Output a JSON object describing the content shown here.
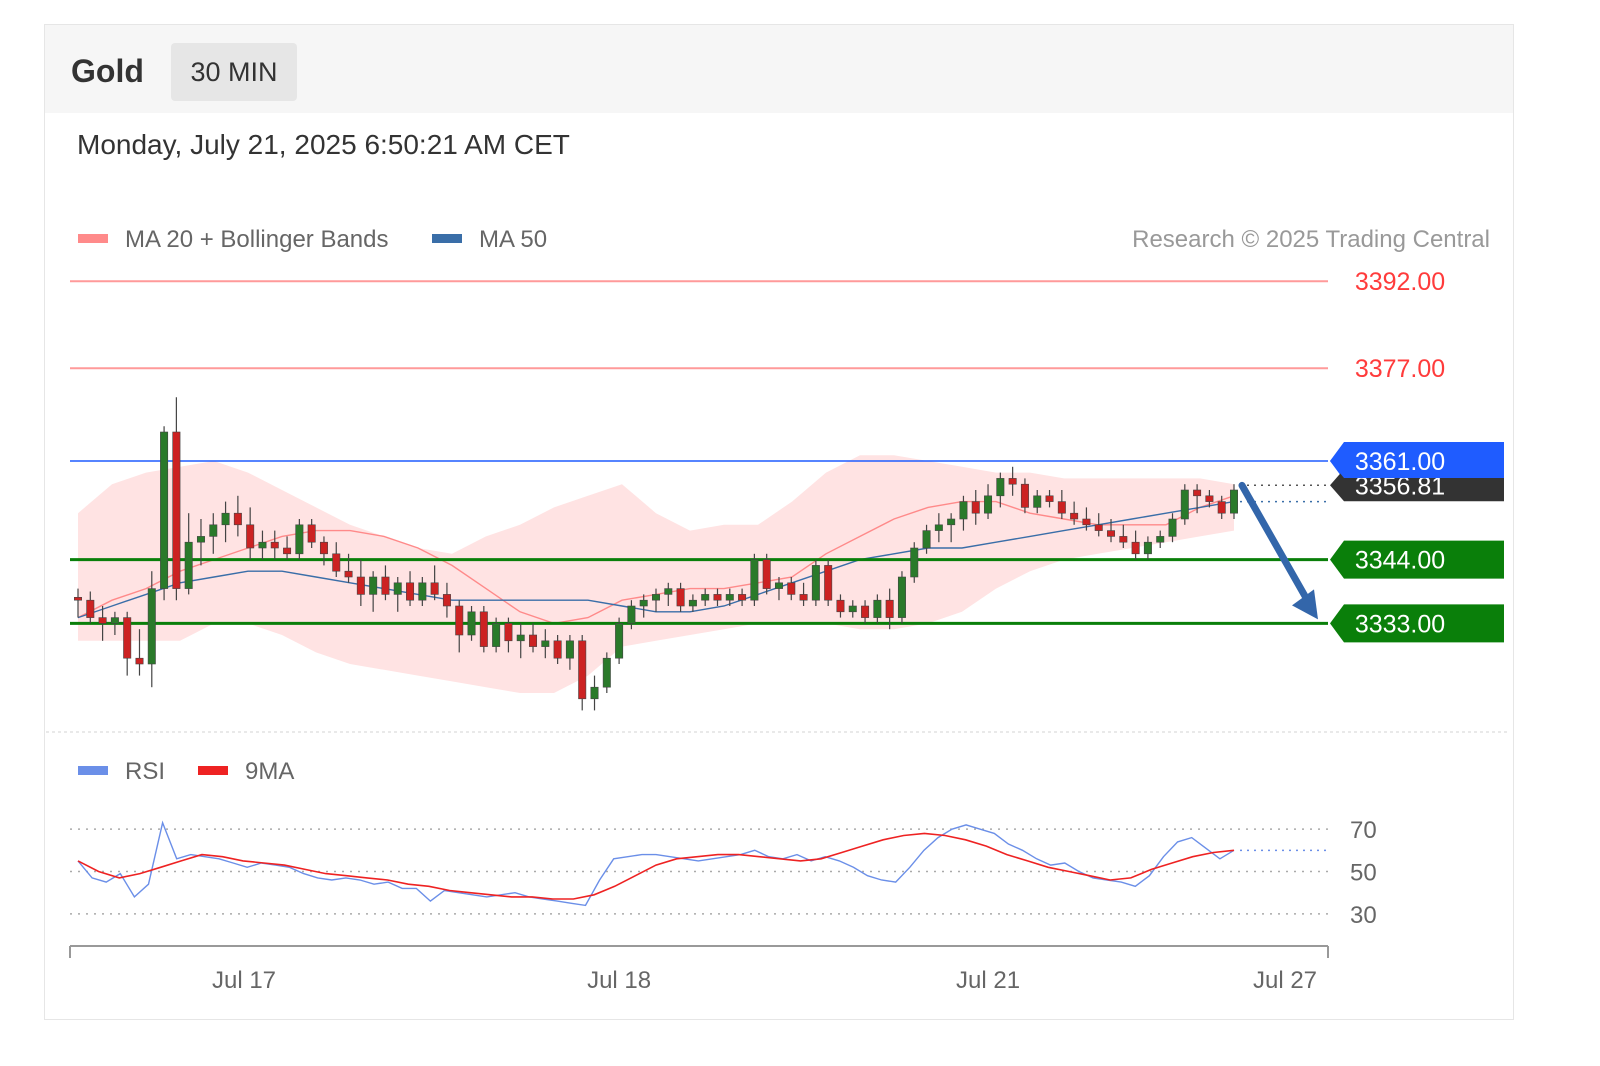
{
  "header": {
    "symbol": "Gold",
    "timeframe": "30 MIN",
    "timestamp": "Monday, July 21, 2025 6:50:21 AM CET"
  },
  "colors": {
    "resistance": "#ff9a9a",
    "resistance_text": "#ff3b3b",
    "pivot": "#1f5cff",
    "support": "#0a7f0a",
    "bollinger_fill": "#ffe3e3",
    "ma20": "#ff8a8a",
    "ma50": "#3a6ea8",
    "arrow": "#3366aa",
    "candle_up": "#2a7a2a",
    "candle_down": "#cc2222",
    "rsi": "#6b8fe8",
    "rsi_ma": "#ee2222",
    "current_tag": "#333333"
  },
  "chart_data": [
    {
      "type": "candlestick",
      "title": "",
      "legend": [
        "MA 20 + Bollinger Bands",
        "MA 50"
      ],
      "legend_placement": "top-left",
      "credit": "Research © 2025 Trading Central",
      "x_ticks": [
        "Jul 17",
        "Jul 18",
        "Jul 21",
        "Jul 27"
      ],
      "ylim": [
        3316,
        3396
      ],
      "levels": [
        {
          "label": "3392.00",
          "value": 3392,
          "kind": "resistance"
        },
        {
          "label": "3377.00",
          "value": 3377,
          "kind": "resistance"
        },
        {
          "label": "3361.00",
          "value": 3361,
          "kind": "pivot"
        },
        {
          "label": "3344.00",
          "value": 3344,
          "kind": "support"
        },
        {
          "label": "3333.00",
          "value": 3333,
          "kind": "support"
        }
      ],
      "current_price": {
        "label": "3356.81",
        "value": 3356.81
      },
      "forecast_arrow": {
        "from": 3356.8,
        "to": 3333,
        "direction": "down"
      },
      "candles": [
        [
          3337.5,
          3339,
          3334,
          3337
        ],
        [
          3337,
          3338.5,
          3333,
          3334
        ],
        [
          3334,
          3336,
          3330,
          3333
        ],
        [
          3333,
          3335,
          3331,
          3334
        ],
        [
          3334,
          3335,
          3324,
          3327
        ],
        [
          3327,
          3332,
          3324,
          3326
        ],
        [
          3326,
          3342,
          3322,
          3339
        ],
        [
          3339,
          3367,
          3337,
          3366
        ],
        [
          3366,
          3372,
          3337,
          3339
        ],
        [
          3339,
          3352,
          3338,
          3347
        ],
        [
          3347,
          3351,
          3343,
          3348
        ],
        [
          3348,
          3352,
          3345,
          3350
        ],
        [
          3350,
          3354,
          3347,
          3352
        ],
        [
          3352,
          3355,
          3348,
          3350
        ],
        [
          3350,
          3353,
          3344,
          3346
        ],
        [
          3346,
          3349,
          3344,
          3347
        ],
        [
          3347,
          3349,
          3344,
          3346
        ],
        [
          3346,
          3348,
          3344,
          3345
        ],
        [
          3345,
          3351,
          3344,
          3350
        ],
        [
          3350,
          3351,
          3346,
          3347
        ],
        [
          3347,
          3348,
          3343,
          3345
        ],
        [
          3345,
          3347,
          3341,
          3342
        ],
        [
          3342,
          3345,
          3340,
          3341
        ],
        [
          3341,
          3344,
          3336,
          3338
        ],
        [
          3338,
          3342,
          3335,
          3341
        ],
        [
          3341,
          3343,
          3337,
          3338
        ],
        [
          3338,
          3341,
          3335,
          3340
        ],
        [
          3340,
          3342,
          3336,
          3337
        ],
        [
          3337,
          3341,
          3336,
          3340
        ],
        [
          3340,
          3343,
          3337,
          3338
        ],
        [
          3338,
          3340,
          3334,
          3336
        ],
        [
          3336,
          3337,
          3328,
          3331
        ],
        [
          3331,
          3336,
          3330,
          3335
        ],
        [
          3335,
          3336,
          3328,
          3329
        ],
        [
          3329,
          3334,
          3328,
          3333
        ],
        [
          3333,
          3334,
          3328,
          3330
        ],
        [
          3330,
          3333,
          3327,
          3331
        ],
        [
          3331,
          3333,
          3328,
          3329
        ],
        [
          3329,
          3332,
          3327,
          3330
        ],
        [
          3330,
          3331,
          3326,
          3327
        ],
        [
          3327,
          3331,
          3325,
          3330
        ],
        [
          3330,
          3331,
          3318,
          3320
        ],
        [
          3320,
          3324,
          3318,
          3322
        ],
        [
          3322,
          3328,
          3321,
          3327
        ],
        [
          3327,
          3334,
          3326,
          3333
        ],
        [
          3333,
          3337,
          3332,
          3336
        ],
        [
          3336,
          3338,
          3334,
          3337
        ],
        [
          3337,
          3339,
          3335,
          3338
        ],
        [
          3338,
          3340,
          3336,
          3339
        ],
        [
          3339,
          3340,
          3335,
          3336
        ],
        [
          3336,
          3338,
          3335,
          3337
        ],
        [
          3337,
          3339,
          3336,
          3338
        ],
        [
          3338,
          3339,
          3336,
          3337
        ],
        [
          3337,
          3339,
          3336,
          3338
        ],
        [
          3338,
          3339,
          3336,
          3337
        ],
        [
          3337,
          3345,
          3336,
          3344
        ],
        [
          3344,
          3345,
          3338,
          3339
        ],
        [
          3339,
          3341,
          3337,
          3340
        ],
        [
          3340,
          3341,
          3337,
          3338
        ],
        [
          3338,
          3340,
          3336,
          3337
        ],
        [
          3337,
          3344,
          3336,
          3343
        ],
        [
          3343,
          3344,
          3336,
          3337
        ],
        [
          3337,
          3338,
          3334,
          3335
        ],
        [
          3335,
          3337,
          3334,
          3336
        ],
        [
          3336,
          3337,
          3333,
          3334
        ],
        [
          3334,
          3338,
          3333,
          3337
        ],
        [
          3337,
          3339,
          3332,
          3334
        ],
        [
          3334,
          3342,
          3333,
          3341
        ],
        [
          3341,
          3347,
          3340,
          3346
        ],
        [
          3346,
          3350,
          3345,
          3349
        ],
        [
          3349,
          3352,
          3347,
          3350
        ],
        [
          3350,
          3352,
          3347,
          3351
        ],
        [
          3351,
          3355,
          3349,
          3354
        ],
        [
          3354,
          3356,
          3350,
          3352
        ],
        [
          3352,
          3357,
          3351,
          3355
        ],
        [
          3355,
          3359,
          3353,
          3358
        ],
        [
          3358,
          3360,
          3355,
          3357
        ],
        [
          3357,
          3358,
          3352,
          3353
        ],
        [
          3353,
          3356,
          3352,
          3355
        ],
        [
          3355,
          3356,
          3353,
          3354
        ],
        [
          3354,
          3356,
          3351,
          3352
        ],
        [
          3352,
          3354,
          3350,
          3351
        ],
        [
          3351,
          3353,
          3349,
          3350
        ],
        [
          3350,
          3352,
          3348,
          3349
        ],
        [
          3349,
          3351,
          3347,
          3348
        ],
        [
          3348,
          3350,
          3346,
          3347
        ],
        [
          3347,
          3349,
          3344,
          3345
        ],
        [
          3345,
          3348,
          3344,
          3347
        ],
        [
          3347,
          3349,
          3346,
          3348
        ],
        [
          3348,
          3352,
          3347,
          3351
        ],
        [
          3351,
          3357,
          3350,
          3356
        ],
        [
          3356,
          3357,
          3352,
          3355
        ],
        [
          3355,
          3356,
          3353,
          3354
        ],
        [
          3354,
          3355,
          3351,
          3352
        ],
        [
          3352,
          3357,
          3351,
          3356
        ]
      ],
      "ma20": [
        3334,
        3337,
        3339,
        3342,
        3344,
        3346,
        3348,
        3349,
        3349,
        3348,
        3346,
        3343,
        3339,
        3335,
        3333,
        3334,
        3337,
        3338,
        3339,
        3339,
        3340,
        3341,
        3345,
        3348,
        3351,
        3353,
        3354,
        3354,
        3352,
        3351,
        3350,
        3350,
        3350,
        3353,
        3355
      ],
      "ma50": [
        3334,
        3336,
        3338,
        3340,
        3341,
        3342,
        3342,
        3341,
        3340,
        3339,
        3338,
        3337,
        3337,
        3337,
        3337,
        3337,
        3336,
        3335,
        3335,
        3336,
        3338,
        3340,
        3342,
        3344,
        3345,
        3346,
        3346,
        3347,
        3348,
        3349,
        3350,
        3351,
        3352,
        3353,
        3354
      ],
      "bb_upper": [
        3352,
        3357,
        3359,
        3360,
        3361,
        3359,
        3356,
        3353,
        3350,
        3348,
        3346,
        3345,
        3348,
        3350,
        3353,
        3355,
        3357,
        3352,
        3349,
        3350,
        3350,
        3354,
        3359,
        3362,
        3362,
        3361,
        3360,
        3359,
        3359,
        3358,
        3358,
        3358,
        3358,
        3358,
        3357
      ],
      "bb_lower": [
        3330,
        3330,
        3330,
        3330,
        3333,
        3333,
        3331,
        3328,
        3326,
        3325,
        3324,
        3323,
        3322,
        3321,
        3321,
        3324,
        3329,
        3330,
        3331,
        3332,
        3333,
        3333,
        3333,
        3332,
        3332,
        3333,
        3335,
        3339,
        3342,
        3344,
        3345,
        3346,
        3347,
        3348,
        3349
      ]
    },
    {
      "type": "line",
      "legend": [
        "RSI",
        "9MA"
      ],
      "legend_placement": "top-left",
      "y_ticks": [
        "70",
        "50",
        "30"
      ],
      "ylim": [
        20,
        80
      ],
      "rsi": [
        55,
        47,
        45,
        49,
        38,
        44,
        73,
        56,
        58,
        57,
        56,
        54,
        52,
        54,
        53,
        52,
        49,
        47,
        46,
        47,
        46,
        44,
        45,
        42,
        42,
        36,
        41,
        40,
        39,
        38,
        39,
        40,
        38,
        37,
        36,
        35,
        34,
        46,
        56,
        57,
        58,
        58,
        57,
        56,
        55,
        56,
        57,
        58,
        60,
        57,
        56,
        58,
        55,
        57,
        55,
        52,
        48,
        46,
        45,
        52,
        60,
        66,
        70,
        72,
        70,
        68,
        63,
        60,
        56,
        53,
        54,
        50,
        47,
        46,
        45,
        43,
        48,
        57,
        64,
        66,
        61,
        56,
        60
      ],
      "rsi_ma": [
        55,
        50,
        47,
        49,
        52,
        55,
        58,
        57,
        55,
        54,
        53,
        51,
        49,
        48,
        47,
        46,
        44,
        43,
        41,
        40,
        39,
        38,
        38,
        37,
        37,
        39,
        43,
        48,
        53,
        56,
        57,
        58,
        58,
        57,
        56,
        55,
        56,
        59,
        62,
        65,
        67,
        68,
        67,
        65,
        62,
        58,
        55,
        52,
        50,
        48,
        46,
        47,
        51,
        54,
        57,
        59,
        60
      ]
    }
  ]
}
